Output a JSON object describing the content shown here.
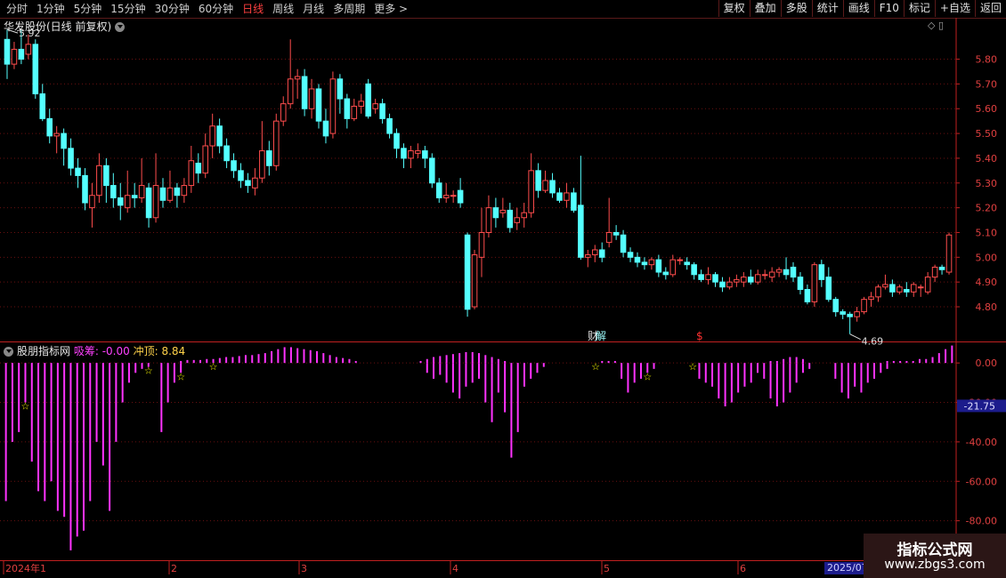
{
  "toolbar": {
    "periods": [
      "分时",
      "1分钟",
      "5分钟",
      "15分钟",
      "30分钟",
      "60分钟",
      "日线",
      "周线",
      "月线",
      "多周期",
      "更多 >"
    ],
    "active_period": "日线",
    "buttons": [
      "复权",
      "叠加",
      "多股",
      "统计",
      "画线",
      "F10",
      "标记",
      "+自选",
      "返回"
    ]
  },
  "main_panel": {
    "title": "华发股份(日线 前复权)",
    "high_label": "5.92",
    "low_label": "4.69",
    "event_label_1": "财",
    "event_label_2": "解",
    "event_label_3": "$"
  },
  "sub_panel": {
    "indicator_name": "股朋指标网",
    "value_1": "吸筹: -0.00",
    "value_2": "冲顶: 8.84",
    "current_label": "-21.75"
  },
  "date_axis": {
    "labels": [
      "2024年1",
      "2",
      "3",
      "4",
      "5",
      "6"
    ],
    "highlight": "2025/07"
  },
  "watermark": {
    "line1": "指标公式网",
    "line2": "www.zbgs3.com"
  },
  "colors": {
    "up": "#ff4d4d",
    "down": "#54ffff",
    "indicator": "#ff33ff",
    "star": "#ffff00",
    "grid": "#6a1010",
    "axis": "#c02020"
  },
  "chart_data": [
    {
      "type": "candlestick",
      "title": "华发股份(日线 前复权)",
      "y_axis_ticks": [
        4.8,
        4.9,
        5.0,
        5.1,
        5.2,
        5.3,
        5.4,
        5.5,
        5.6,
        5.7,
        5.8
      ],
      "ylim": [
        4.66,
        5.96
      ],
      "annotations": [
        {
          "label": "5.92",
          "type": "high"
        },
        {
          "label": "4.69",
          "type": "low"
        }
      ],
      "candles": [
        [
          5.88,
          5.78,
          5.92,
          5.72
        ],
        [
          5.78,
          5.84,
          5.87,
          5.76
        ],
        [
          5.84,
          5.8,
          5.92,
          5.78
        ],
        [
          5.82,
          5.86,
          5.9,
          5.8
        ],
        [
          5.86,
          5.66,
          5.88,
          5.64
        ],
        [
          5.66,
          5.56,
          5.7,
          5.55
        ],
        [
          5.56,
          5.49,
          5.6,
          5.46
        ],
        [
          5.49,
          5.5,
          5.53,
          5.42
        ],
        [
          5.5,
          5.44,
          5.52,
          5.37
        ],
        [
          5.44,
          5.36,
          5.48,
          5.33
        ],
        [
          5.36,
          5.33,
          5.4,
          5.28
        ],
        [
          5.33,
          5.22,
          5.36,
          5.19
        ],
        [
          5.2,
          5.25,
          5.3,
          5.12
        ],
        [
          5.25,
          5.37,
          5.42,
          5.22
        ],
        [
          5.37,
          5.29,
          5.4,
          5.22
        ],
        [
          5.29,
          5.24,
          5.34,
          5.2
        ],
        [
          5.24,
          5.21,
          5.3,
          5.15
        ],
        [
          5.2,
          5.25,
          5.35,
          5.18
        ],
        [
          5.25,
          5.24,
          5.3,
          5.2
        ],
        [
          5.24,
          5.29,
          5.4,
          5.22
        ],
        [
          5.28,
          5.16,
          5.3,
          5.12
        ],
        [
          5.16,
          5.29,
          5.42,
          5.14
        ],
        [
          5.28,
          5.23,
          5.32,
          5.2
        ],
        [
          5.23,
          5.28,
          5.35,
          5.22
        ],
        [
          5.28,
          5.25,
          5.3,
          5.2
        ],
        [
          5.25,
          5.29,
          5.32,
          5.22
        ],
        [
          5.29,
          5.39,
          5.45,
          5.26
        ],
        [
          5.38,
          5.34,
          5.42,
          5.3
        ],
        [
          5.34,
          5.45,
          5.5,
          5.32
        ],
        [
          5.45,
          5.53,
          5.58,
          5.4
        ],
        [
          5.53,
          5.45,
          5.56,
          5.42
        ],
        [
          5.45,
          5.39,
          5.48,
          5.36
        ],
        [
          5.39,
          5.35,
          5.42,
          5.32
        ],
        [
          5.35,
          5.31,
          5.38,
          5.28
        ],
        [
          5.31,
          5.29,
          5.34,
          5.26
        ],
        [
          5.28,
          5.32,
          5.36,
          5.25
        ],
        [
          5.32,
          5.43,
          5.55,
          5.3
        ],
        [
          5.43,
          5.37,
          5.47,
          5.33
        ],
        [
          5.37,
          5.55,
          5.58,
          5.35
        ],
        [
          5.55,
          5.62,
          5.65,
          5.53
        ],
        [
          5.62,
          5.72,
          5.88,
          5.6
        ],
        [
          5.72,
          5.73,
          5.76,
          5.64
        ],
        [
          5.73,
          5.6,
          5.76,
          5.57
        ],
        [
          5.6,
          5.68,
          5.72,
          5.56
        ],
        [
          5.68,
          5.55,
          5.7,
          5.52
        ],
        [
          5.55,
          5.49,
          5.6,
          5.46
        ],
        [
          5.5,
          5.72,
          5.75,
          5.48
        ],
        [
          5.72,
          5.64,
          5.74,
          5.58
        ],
        [
          5.64,
          5.56,
          5.66,
          5.52
        ],
        [
          5.56,
          5.61,
          5.64,
          5.55
        ],
        [
          5.61,
          5.63,
          5.66,
          5.58
        ],
        [
          5.7,
          5.57,
          5.72,
          5.56
        ],
        [
          5.6,
          5.62,
          5.64,
          5.58
        ],
        [
          5.62,
          5.56,
          5.64,
          5.54
        ],
        [
          5.56,
          5.5,
          5.58,
          5.48
        ],
        [
          5.5,
          5.44,
          5.52,
          5.4
        ],
        [
          5.44,
          5.4,
          5.46,
          5.36
        ],
        [
          5.4,
          5.43,
          5.45,
          5.36
        ],
        [
          5.42,
          5.43,
          5.46,
          5.4
        ],
        [
          5.43,
          5.4,
          5.45,
          5.36
        ],
        [
          5.4,
          5.3,
          5.42,
          5.28
        ],
        [
          5.3,
          5.24,
          5.32,
          5.22
        ],
        [
          5.24,
          5.25,
          5.3,
          5.22
        ],
        [
          5.25,
          5.25,
          5.27,
          5.22
        ],
        [
          5.27,
          5.22,
          5.32,
          5.2
        ],
        [
          5.09,
          4.79,
          5.1,
          4.76
        ],
        [
          4.8,
          5.01,
          5.03,
          4.79
        ],
        [
          5.0,
          5.1,
          5.2,
          4.92
        ],
        [
          5.1,
          5.2,
          5.25,
          5.08
        ],
        [
          5.2,
          5.16,
          5.24,
          5.12
        ],
        [
          5.18,
          5.19,
          5.24,
          5.16
        ],
        [
          5.19,
          5.12,
          5.22,
          5.1
        ],
        [
          5.14,
          5.16,
          5.2,
          5.11
        ],
        [
          5.16,
          5.18,
          5.22,
          5.12
        ],
        [
          5.18,
          5.35,
          5.42,
          5.16
        ],
        [
          5.35,
          5.27,
          5.38,
          5.24
        ],
        [
          5.27,
          5.31,
          5.35,
          5.26
        ],
        [
          5.31,
          5.26,
          5.34,
          5.24
        ],
        [
          5.26,
          5.23,
          5.28,
          5.22
        ],
        [
          5.23,
          5.26,
          5.3,
          5.2
        ],
        [
          5.26,
          5.19,
          5.28,
          5.18
        ],
        [
          5.21,
          5.0,
          5.41,
          4.99
        ],
        [
          5.0,
          5.01,
          5.03,
          4.96
        ],
        [
          5.01,
          5.03,
          5.05,
          4.98
        ],
        [
          5.03,
          5.0,
          5.06,
          4.98
        ],
        [
          5.06,
          5.1,
          5.24,
          5.04
        ],
        [
          5.1,
          5.09,
          5.13,
          5.07
        ],
        [
          5.09,
          5.02,
          5.11,
          5.0
        ],
        [
          5.02,
          5.0,
          5.04,
          4.98
        ],
        [
          5.0,
          4.98,
          5.02,
          4.96
        ],
        [
          4.98,
          4.97,
          5.0,
          4.95
        ],
        [
          4.97,
          4.99,
          5.0,
          4.95
        ],
        [
          4.99,
          4.94,
          5.01,
          4.92
        ],
        [
          4.94,
          4.93,
          4.96,
          4.91
        ],
        [
          4.93,
          4.99,
          5.01,
          4.92
        ],
        [
          4.99,
          4.99,
          5.0,
          4.97
        ],
        [
          4.98,
          4.97,
          5.0,
          4.95
        ],
        [
          4.97,
          4.93,
          4.98,
          4.91
        ],
        [
          4.93,
          4.91,
          4.95,
          4.9
        ],
        [
          4.91,
          4.93,
          4.96,
          4.89
        ],
        [
          4.93,
          4.9,
          4.94,
          4.88
        ],
        [
          4.9,
          4.88,
          4.92,
          4.86
        ],
        [
          4.88,
          4.9,
          4.92,
          4.87
        ],
        [
          4.9,
          4.91,
          4.93,
          4.88
        ],
        [
          4.9,
          4.92,
          4.94,
          4.88
        ],
        [
          4.92,
          4.9,
          4.95,
          4.89
        ],
        [
          4.9,
          4.93,
          4.95,
          4.89
        ],
        [
          4.93,
          4.93,
          4.95,
          4.91
        ],
        [
          4.92,
          4.94,
          4.96,
          4.9
        ],
        [
          4.94,
          4.95,
          4.96,
          4.92
        ],
        [
          4.95,
          4.93,
          5.0,
          4.91
        ],
        [
          4.96,
          4.92,
          4.98,
          4.9
        ],
        [
          4.92,
          4.87,
          4.94,
          4.85
        ],
        [
          4.87,
          4.82,
          4.89,
          4.81
        ],
        [
          4.82,
          4.97,
          4.98,
          4.8
        ],
        [
          4.97,
          4.91,
          4.99,
          4.88
        ],
        [
          4.92,
          4.83,
          4.96,
          4.82
        ],
        [
          4.83,
          4.78,
          4.84,
          4.76
        ],
        [
          4.78,
          4.77,
          4.79,
          4.75
        ],
        [
          4.77,
          4.76,
          4.78,
          4.69
        ],
        [
          4.76,
          4.78,
          4.8,
          4.74
        ],
        [
          4.78,
          4.83,
          4.84,
          4.77
        ],
        [
          4.83,
          4.84,
          4.86,
          4.8
        ],
        [
          4.84,
          4.88,
          4.89,
          4.82
        ],
        [
          4.88,
          4.89,
          4.93,
          4.87
        ],
        [
          4.89,
          4.86,
          4.91,
          4.84
        ],
        [
          4.86,
          4.88,
          4.89,
          4.85
        ],
        [
          4.87,
          4.86,
          4.9,
          4.84
        ],
        [
          4.86,
          4.89,
          4.9,
          4.84
        ],
        [
          4.88,
          4.88,
          4.89,
          4.84
        ],
        [
          4.86,
          4.92,
          4.94,
          4.85
        ],
        [
          4.92,
          4.96,
          4.97,
          4.9
        ],
        [
          4.96,
          4.95,
          4.97,
          4.93
        ],
        [
          4.94,
          5.09,
          5.1,
          4.93
        ]
      ]
    },
    {
      "type": "bar",
      "title": "股朋指标网",
      "y_axis_ticks": [
        0.0,
        -20.0,
        -40.0,
        -60.0,
        -80.0
      ],
      "ylim": [
        -100,
        10
      ],
      "series": [
        {
          "name": "吸筹",
          "values": [
            -70,
            -40,
            -35,
            -20,
            -50,
            -65,
            -70,
            -60,
            -75,
            -78,
            -95,
            -88,
            -85,
            -70,
            -40,
            -52,
            -75,
            -40,
            -20,
            -10,
            -5,
            -3,
            -2,
            0,
            -35,
            -20,
            -10,
            -5,
            0,
            0,
            0,
            0,
            0,
            0,
            0,
            0,
            0,
            0,
            0,
            0,
            0,
            0,
            0,
            0,
            0,
            0,
            0,
            0,
            0,
            0,
            0,
            0,
            0,
            0,
            0,
            0,
            0,
            0,
            0,
            0,
            0,
            0,
            0,
            0,
            0,
            -5,
            -8,
            -6,
            -10,
            -15,
            -18,
            -12,
            -10,
            -8,
            -20,
            -30,
            -15,
            -25,
            -48,
            -35,
            -12,
            -8,
            -5,
            -2,
            0,
            0,
            0,
            0,
            0,
            0,
            0,
            0,
            0,
            0,
            0,
            -8,
            -15,
            -10,
            -8,
            -5,
            -3,
            0,
            0,
            0,
            0,
            0,
            0,
            -8,
            -10,
            -12,
            -18,
            -22,
            -20,
            -15,
            -12,
            -10,
            -5,
            -8,
            -18,
            -22,
            -20,
            -15,
            -10,
            -5,
            -3,
            0,
            0,
            0,
            -8,
            -15,
            -18,
            -12,
            -15,
            -10,
            -8,
            -5,
            -3,
            0,
            0,
            0,
            0,
            0,
            0,
            0,
            0,
            0,
            0
          ]
        },
        {
          "name": "冲顶",
          "values": [
            0,
            0,
            0,
            0,
            0,
            0,
            0,
            0,
            0,
            0,
            0,
            0,
            0,
            0,
            0,
            0,
            0,
            0,
            0,
            0,
            0,
            0,
            0,
            0,
            0,
            0,
            0,
            1,
            1.5,
            1.5,
            1.5,
            2,
            2,
            2.5,
            3,
            3,
            3.5,
            4,
            4,
            4.5,
            5,
            6,
            7,
            8,
            8,
            7.5,
            7,
            6.5,
            6,
            5,
            4,
            3,
            2.5,
            2,
            1,
            0,
            0,
            0,
            0,
            0,
            0,
            0,
            0,
            0,
            1,
            2,
            3,
            3.5,
            4,
            4.5,
            5,
            5.5,
            5.5,
            5,
            4,
            3,
            2,
            1,
            0,
            0,
            0,
            0,
            0,
            0,
            0,
            0,
            0,
            0,
            0,
            0,
            0,
            0,
            1,
            1,
            1,
            0,
            0,
            0,
            0,
            0,
            0,
            0,
            0,
            0,
            0,
            0,
            0,
            0,
            0,
            0,
            0,
            0,
            0,
            0,
            0,
            0,
            0,
            0,
            1,
            1,
            2,
            3,
            3,
            2,
            0,
            0,
            0,
            0,
            0,
            0,
            0,
            0,
            0,
            0,
            0,
            0,
            1,
            1,
            1,
            1,
            1,
            2,
            2,
            3,
            5,
            7,
            8.84
          ]
        }
      ],
      "star_indices": [
        3,
        22,
        27,
        32,
        91,
        99,
        106,
        163,
        174,
        187,
        205,
        214,
        222,
        230
      ]
    }
  ]
}
